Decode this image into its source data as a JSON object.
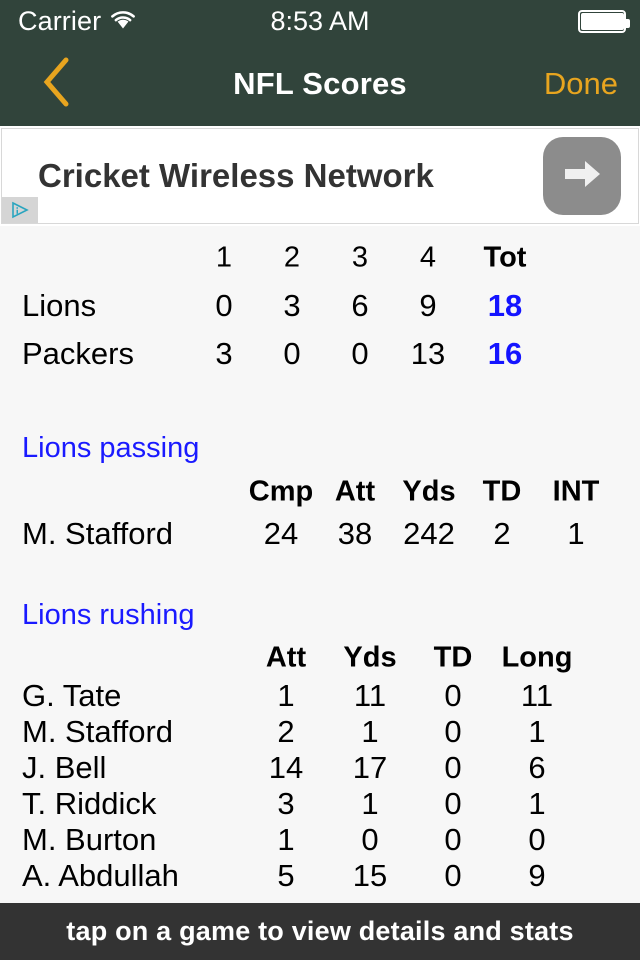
{
  "status_bar": {
    "carrier": "Carrier",
    "time": "8:53 AM",
    "wifi_icon": "wifi-icon",
    "battery_icon": "battery-full-icon"
  },
  "nav_bar": {
    "back_icon": "chevron-left-icon",
    "title": "NFL Scores",
    "done_label": "Done",
    "background_color": "#31443b",
    "accent_color": "#e8a51f"
  },
  "ad": {
    "headline": "Cricket Wireless Network",
    "cta_icon": "arrow-right-icon",
    "adchoices_icon": "adchoices-icon"
  },
  "scoreboard": {
    "columns": [
      "1",
      "2",
      "3",
      "4",
      "Tot"
    ],
    "rows": [
      {
        "team": "Lions",
        "periods": [
          "0",
          "3",
          "6",
          "9"
        ],
        "total": "18"
      },
      {
        "team": "Packers",
        "periods": [
          "3",
          "0",
          "0",
          "13"
        ],
        "total": "16"
      }
    ],
    "total_color": "#1414ff"
  },
  "passing": {
    "title": "Lions passing",
    "columns": [
      "Cmp",
      "Att",
      "Yds",
      "TD",
      "INT"
    ],
    "rows": [
      {
        "player": "M. Stafford",
        "values": [
          "24",
          "38",
          "242",
          "2",
          "1"
        ]
      }
    ]
  },
  "rushing": {
    "title": "Lions rushing",
    "columns": [
      "Att",
      "Yds",
      "TD",
      "Long"
    ],
    "rows": [
      {
        "player": "G. Tate",
        "values": [
          "1",
          "11",
          "0",
          "11"
        ]
      },
      {
        "player": "M. Stafford",
        "values": [
          "2",
          "1",
          "0",
          "1"
        ]
      },
      {
        "player": "J. Bell",
        "values": [
          "14",
          "17",
          "0",
          "6"
        ]
      },
      {
        "player": "T. Riddick",
        "values": [
          "3",
          "1",
          "0",
          "1"
        ]
      },
      {
        "player": "M. Burton",
        "values": [
          "1",
          "0",
          "0",
          "0"
        ]
      },
      {
        "player": "A. Abdullah",
        "values": [
          "5",
          "15",
          "0",
          "9"
        ]
      }
    ]
  },
  "bottom_bar": {
    "hint": "tap on a game to view details and stats"
  }
}
